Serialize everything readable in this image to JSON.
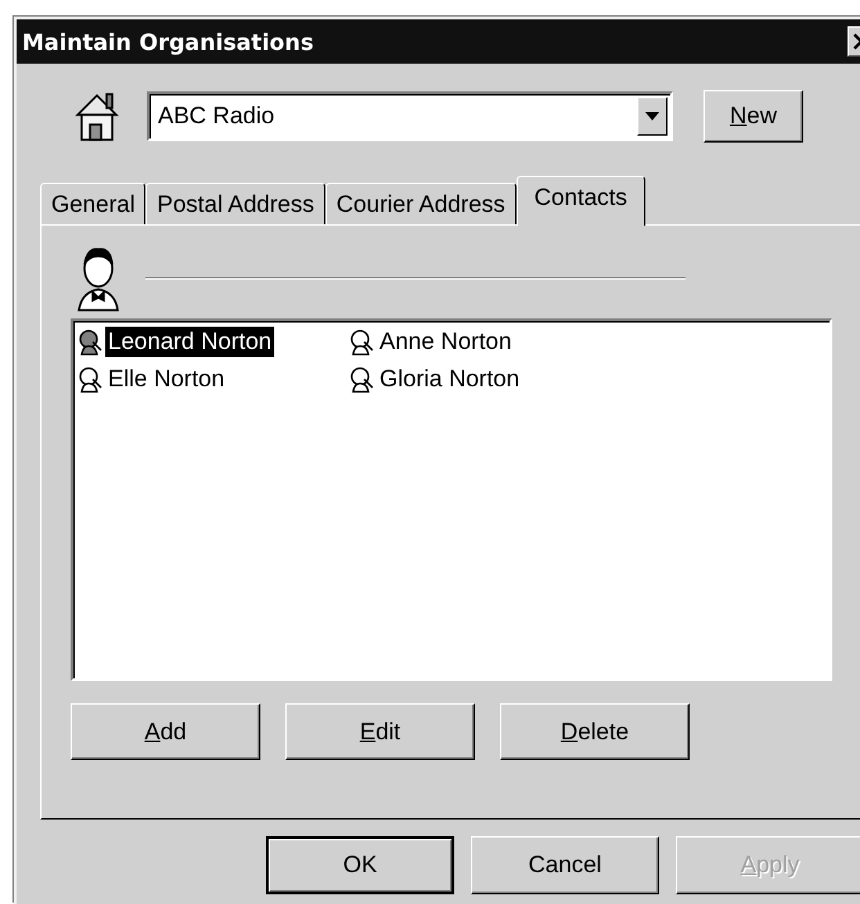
{
  "window": {
    "title": "Maintain Organisations"
  },
  "organisation": {
    "value": "ABC Radio"
  },
  "new_button": {
    "label": "New",
    "underline_first": true
  },
  "tabs": [
    {
      "label": "General",
      "selected": false
    },
    {
      "label": "Postal Address",
      "selected": false
    },
    {
      "label": "Courier Address",
      "selected": false
    },
    {
      "label": "Contacts",
      "selected": true
    }
  ],
  "contacts": [
    {
      "name": "Leonard Norton",
      "selected": true
    },
    {
      "name": "Anne Norton",
      "selected": false
    },
    {
      "name": "Elle Norton",
      "selected": false
    },
    {
      "name": "Gloria Norton",
      "selected": false
    }
  ],
  "contact_buttons": [
    {
      "label": "Add",
      "underline_first": true
    },
    {
      "label": "Edit",
      "underline_first": true
    },
    {
      "label": "Delete",
      "underline_first": true
    }
  ],
  "dialog_buttons": [
    {
      "label": "OK",
      "default": true,
      "disabled": false,
      "underline_first": false
    },
    {
      "label": "Cancel",
      "default": false,
      "disabled": false,
      "underline_first": false
    },
    {
      "label": "Apply",
      "default": false,
      "disabled": true,
      "underline_first": true
    }
  ]
}
